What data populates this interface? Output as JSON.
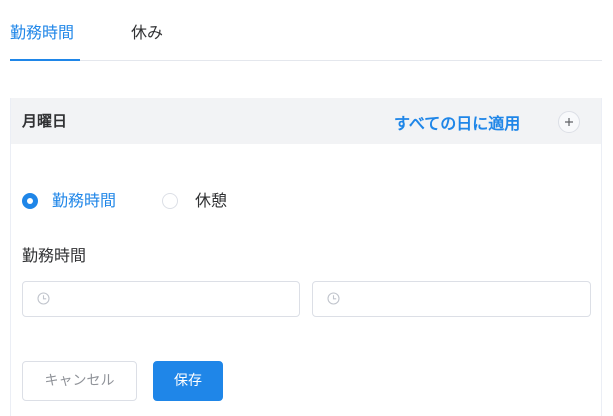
{
  "tabs": [
    {
      "label": "勤務時間",
      "active": true
    },
    {
      "label": "休み",
      "active": false
    }
  ],
  "day_panel": {
    "day_title": "月曜日",
    "apply_all_label": "すべての日に適用",
    "add_icon": "plus-icon"
  },
  "mode_radios": [
    {
      "label": "勤務時間",
      "checked": true
    },
    {
      "label": "休憩",
      "checked": false
    }
  ],
  "section_label": "勤務時間",
  "time_fields": {
    "start": {
      "value": "",
      "icon": "clock-icon"
    },
    "end": {
      "value": "",
      "icon": "clock-icon"
    }
  },
  "actions": {
    "cancel_label": "キャンセル",
    "save_label": "保存"
  },
  "colors": {
    "accent": "#1f86e8",
    "header_bg": "#f2f3f5",
    "border": "#dcdfe6",
    "text": "#303133"
  }
}
